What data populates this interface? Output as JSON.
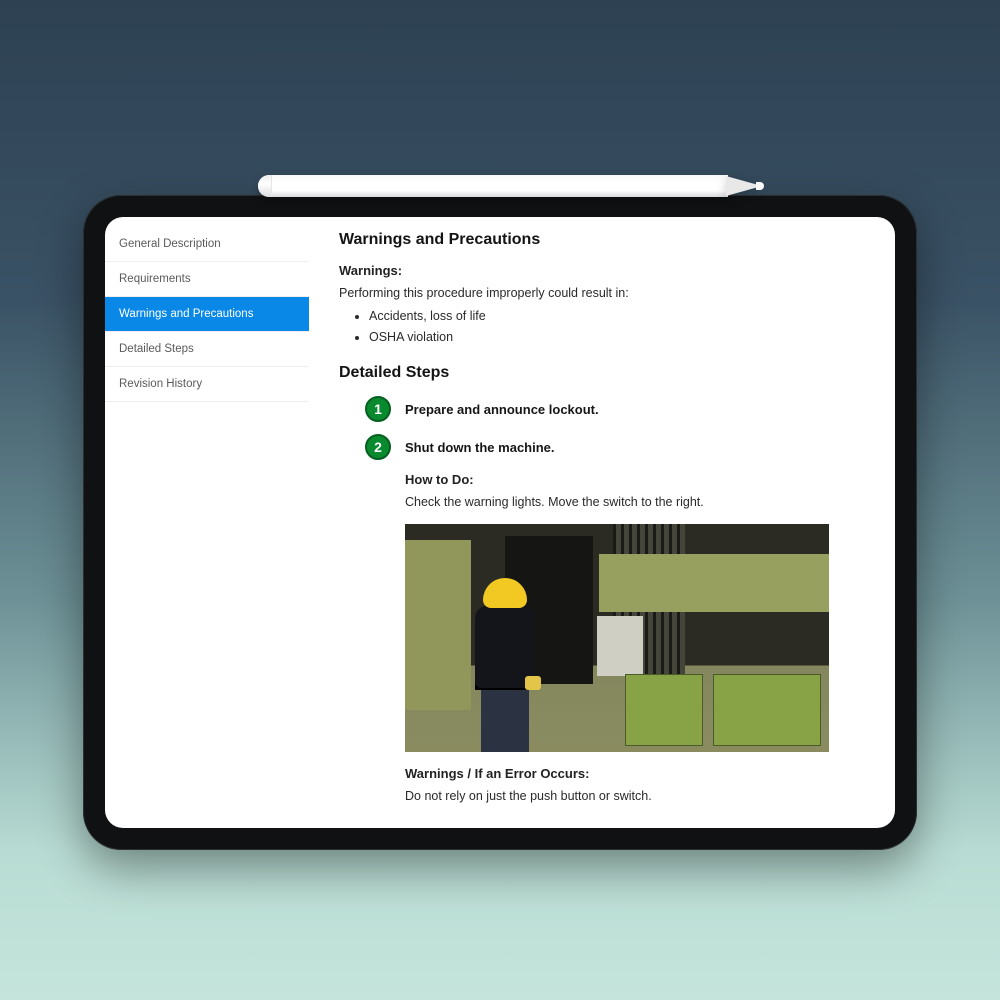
{
  "sidebar": {
    "items": [
      {
        "label": "General Description",
        "active": false
      },
      {
        "label": "Requirements",
        "active": false
      },
      {
        "label": "Warnings and Precautions",
        "active": true
      },
      {
        "label": "Detailed Steps",
        "active": false
      },
      {
        "label": "Revision History",
        "active": false
      }
    ]
  },
  "warnings_section": {
    "heading": "Warnings and Precautions",
    "warnings_label": "Warnings:",
    "intro": "Performing this procedure improperly could result in:",
    "bullets": [
      "Accidents, loss of life",
      "OSHA violation"
    ]
  },
  "steps_section": {
    "heading": "Detailed Steps",
    "steps": [
      {
        "number": "1",
        "title": "Prepare and announce lockout."
      },
      {
        "number": "2",
        "title": "Shut down the machine."
      }
    ],
    "howto_label": "How to Do:",
    "howto_text": "Check the warning lights.  Move the switch to the right.",
    "error_label": "Warnings / If an Error Occurs:",
    "error_text": "Do not rely on just the push button or switch."
  }
}
